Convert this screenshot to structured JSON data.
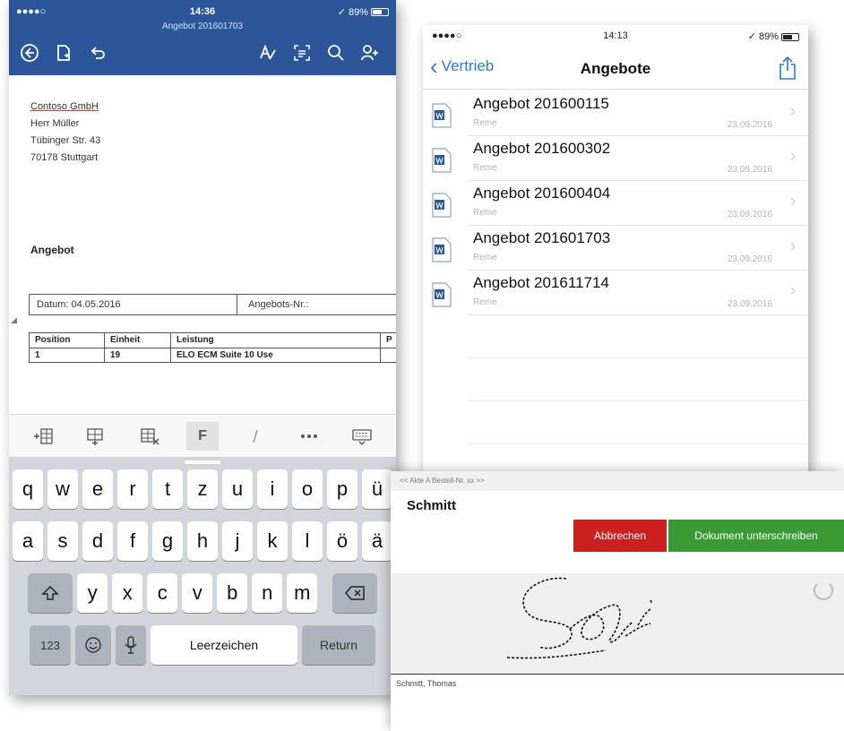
{
  "phone1": {
    "status": {
      "carrier": "●●●●○",
      "time": "14:36",
      "right": "✓ 89%"
    },
    "doc_name": "Angebot 201601703",
    "address": [
      "Contoso GmbH",
      "Herr Müller",
      "Tübinger Str. 43",
      "70178 Stuttgart"
    ],
    "heading": "Angebot",
    "table1": {
      "datum": "Datum: 04.05.2016",
      "nr": "Angebots-Nr.:"
    },
    "table2": {
      "headers": [
        "Position",
        "Einheit",
        "Leistung",
        "P"
      ],
      "row": [
        "1",
        "19",
        "ELO ECM Suite 10 Use",
        ""
      ]
    },
    "format_bold": "F",
    "keyboard": {
      "row1": [
        "q",
        "w",
        "e",
        "r",
        "t",
        "z",
        "u",
        "i",
        "o",
        "p",
        "ü"
      ],
      "row2": [
        "a",
        "s",
        "d",
        "f",
        "g",
        "h",
        "j",
        "k",
        "l",
        "ö",
        "ä"
      ],
      "row3": [
        "y",
        "x",
        "c",
        "v",
        "b",
        "n",
        "m"
      ],
      "num": "123",
      "space": "Leerzeichen",
      "return": "Return"
    }
  },
  "phone2": {
    "status": {
      "carrier": "●●●●○",
      "time": "14:13",
      "right": "✓ 89%"
    },
    "back_label": "Vertrieb",
    "title": "Angebote",
    "items": [
      {
        "title": "Angebot 201600115",
        "sub": "Reme",
        "date": "23.09.2016"
      },
      {
        "title": "Angebot 201600302",
        "sub": "Reme",
        "date": "23.09.2016"
      },
      {
        "title": "Angebot 201600404",
        "sub": "Reme",
        "date": "23.09.2016"
      },
      {
        "title": "Angebot 201601703",
        "sub": "Reme",
        "date": "23.09.2016"
      },
      {
        "title": "Angebot 201611714",
        "sub": "Reme",
        "date": "23.09.2016"
      }
    ]
  },
  "panel3": {
    "topbar": "<<   Akte A  Bestell-Nr. xx   >>",
    "name": "Schmitt",
    "cancel": "Abbrechen",
    "sign": "Dokument unterschreiben",
    "caption": "Schmitt, Thomas"
  }
}
